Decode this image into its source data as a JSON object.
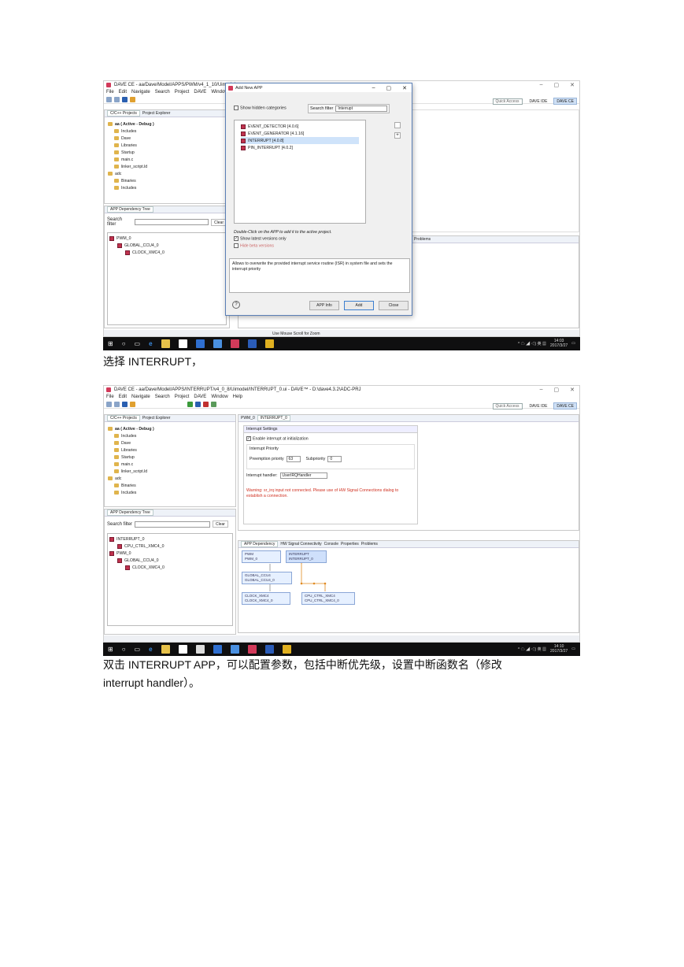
{
  "shot1": {
    "window_title": "DAVE CE - aa/Dave/Model/APPS/PWM/v4_1_10/Uimodel",
    "menu": [
      "File",
      "Edit",
      "Navigate",
      "Search",
      "Project",
      "DAVE",
      "Window"
    ],
    "quick_access": "Quick Access",
    "persp_ide": "DAVE IDE",
    "persp_ce": "DAVE CE",
    "tab_projects": "C/C++ Projects",
    "tab_explorer": "Project Explorer",
    "tree": [
      {
        "label": "aa ( Active - Debug )",
        "indent": 0,
        "bold": true
      },
      {
        "label": "Includes",
        "indent": 1
      },
      {
        "label": "Dave",
        "indent": 1
      },
      {
        "label": "Libraries",
        "indent": 1
      },
      {
        "label": "Startup",
        "indent": 1
      },
      {
        "label": "main.c",
        "indent": 1
      },
      {
        "label": "linker_script.ld",
        "indent": 1
      },
      {
        "label": "adc",
        "indent": 0
      },
      {
        "label": "Binaries",
        "indent": 1
      },
      {
        "label": "Includes",
        "indent": 1
      }
    ],
    "dep_tree_tab": "APP Dependency Tree",
    "search_filter_label": "Search filter",
    "clear_label": "Clear",
    "dep_nodes": [
      "PWM_0",
      "GLOBAL_CCU4_0",
      "CLOCK_XMC4_0"
    ],
    "problems_tab": "Problems",
    "status": "Use Mouse Scroll for Zoom",
    "clock_time": "14:03",
    "clock_date": "2017/3/27",
    "dialog": {
      "title": "Add New APP",
      "show_hidden": "Show hidden categories",
      "search_filter_label": "Search filter",
      "search_value": "Interrupt",
      "items": [
        "EVENT_DETECTOR [4.0.6]",
        "EVENT_GENERATOR [4.1.16]",
        "INTERRUPT [4.0.8]",
        "PIN_INTERRUPT [4.0.2]"
      ],
      "selected_index": 2,
      "hint": "Double-Click on the APP to add it to the active project.",
      "show_latest": "Show latest versions only",
      "hide_beta": "Hide beta versions",
      "description": "Allows to overwrite the provided interrupt service routine (ISR) in system file and sets the interrupt priority",
      "btn_info": "APP Info",
      "btn_add": "Add",
      "btn_close": "Close",
      "help": "?"
    }
  },
  "caption1": "选择 INTERRUPT，",
  "shot2": {
    "window_title": "DAVE CE - aa/Dave/Model/APPS/INTERRUPT/v4_0_8/Uimodel/INTERRUPT_0.ui - DAVE™ - D:\\dave4.3.2\\ADC-PRJ",
    "menu": [
      "File",
      "Edit",
      "Navigate",
      "Search",
      "Project",
      "DAVE",
      "Window",
      "Help"
    ],
    "quick_access": "Quick Access",
    "persp_ide": "DAVE IDE",
    "persp_ce": "DAVE CE",
    "tab_projects": "C/C++ Projects",
    "tab_explorer": "Project Explorer",
    "editor_tabs": [
      "PWM_0",
      "INTERRUPT_0"
    ],
    "tree": [
      {
        "label": "aa ( Active - Debug )",
        "indent": 0,
        "bold": true
      },
      {
        "label": "Includes",
        "indent": 1
      },
      {
        "label": "Dave",
        "indent": 1
      },
      {
        "label": "Libraries",
        "indent": 1
      },
      {
        "label": "Startup",
        "indent": 1
      },
      {
        "label": "main.c",
        "indent": 1
      },
      {
        "label": "linker_script.ld",
        "indent": 1
      },
      {
        "label": "adc",
        "indent": 0
      },
      {
        "label": "Binaries",
        "indent": 1
      },
      {
        "label": "Includes",
        "indent": 1
      }
    ],
    "dep_tree_tab": "APP Dependency Tree",
    "search_filter_label": "Search filter",
    "clear_label": "Clear",
    "dep_tree": [
      {
        "label": "INTERRUPT_0",
        "indent": 0
      },
      {
        "label": "CPU_CTRL_XMC4_0",
        "indent": 1
      },
      {
        "label": "PWM_0",
        "indent": 0
      },
      {
        "label": "GLOBAL_CCU4_0",
        "indent": 1
      },
      {
        "label": "CLOCK_XMC4_0",
        "indent": 2
      }
    ],
    "settings": {
      "section": "Interrupt Settings",
      "enable": "Enable interrupt at initialization",
      "priority_group": "Interrupt Priority",
      "preemption_label": "Preemption priority",
      "preemption_value": "63",
      "sub_label": "Subpriority",
      "sub_value": "0",
      "handler_label": "Interrupt handler:",
      "handler_value": "UserIRQHandler",
      "warning": "Warning: sr_irq input not connected. Please use of HW Signal Connections dialog to establish a connection."
    },
    "bottom_tabs": [
      "APP Dependency",
      "HW Signal Connectivity",
      "Console",
      "Properties",
      "Problems"
    ],
    "graph_nodes": [
      {
        "type": "PWM",
        "name": "PWM_0"
      },
      {
        "type": "INTERRUPT",
        "name": "INTERRUPT_0"
      },
      {
        "type": "GLOBAL_CCU4",
        "name": "GLOBAL_CCU4_0"
      },
      {
        "type": "CLOCK_XMC4",
        "name": "CLOCK_XMC4_0"
      },
      {
        "type": "CPU_CTRL_XMC4",
        "name": "CPU_CTRL_XMC4_0"
      }
    ],
    "clock_time": "14:10",
    "clock_date": "2017/3/27"
  },
  "caption2_line1": "双击 INTERRUPT APP，可以配置参数，包括中断优先级，设置中断函数名（修改",
  "caption2_line2": "interrupt handler）。",
  "colors": {
    "accent": "#3c7fd0",
    "app_icon": "#c0324e",
    "taskbar": "#0f0f10",
    "warning": "#d03020"
  }
}
